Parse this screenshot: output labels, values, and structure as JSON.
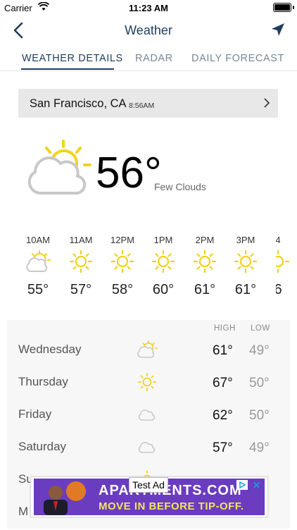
{
  "status_bar": {
    "carrier": "Carrier",
    "time": "11:23 AM"
  },
  "nav": {
    "title": "Weather"
  },
  "tabs": [
    {
      "label": "WEATHER DETAILS",
      "active": true
    },
    {
      "label": "RADAR",
      "active": false
    },
    {
      "label": "DAILY FORECAST",
      "active": false
    }
  ],
  "location": {
    "city": "San Francisco, CA",
    "time": "8:56AM"
  },
  "current": {
    "temp": "56°",
    "condition": "Few Clouds",
    "icon": "partly-sunny-icon"
  },
  "hourly": [
    {
      "time": "10AM",
      "temp": "55°",
      "icon": "partly-sunny-icon"
    },
    {
      "time": "11AM",
      "temp": "57°",
      "icon": "sun-icon"
    },
    {
      "time": "12PM",
      "temp": "58°",
      "icon": "sun-icon"
    },
    {
      "time": "1PM",
      "temp": "60°",
      "icon": "sun-icon"
    },
    {
      "time": "2PM",
      "temp": "61°",
      "icon": "sun-icon"
    },
    {
      "time": "3PM",
      "temp": "61°",
      "icon": "sun-icon"
    },
    {
      "time": "4",
      "temp": "6",
      "icon": "sun-icon"
    }
  ],
  "daily": {
    "high_label": "HIGH",
    "low_label": "LOW",
    "days": [
      {
        "day": "Wednesday",
        "high": "61°",
        "low": "49°",
        "icon": "partly-sunny-icon"
      },
      {
        "day": "Thursday",
        "high": "67°",
        "low": "50°",
        "icon": "sun-icon"
      },
      {
        "day": "Friday",
        "high": "62°",
        "low": "50°",
        "icon": "cloud-icon"
      },
      {
        "day": "Saturday",
        "high": "57°",
        "low": "49°",
        "icon": "cloud-icon"
      },
      {
        "day": "Su",
        "high": "",
        "low": "",
        "icon": "sun-icon"
      },
      {
        "day": "M",
        "high": "",
        "low": "",
        "icon": "sun-icon"
      }
    ]
  },
  "ad": {
    "label": "Test Ad",
    "line1": "APARTMENTS.COM",
    "line2": "MOVE IN BEFORE TIP-OFF."
  },
  "colors": {
    "accent": "#1f3d5c",
    "sun": "#f2d21b",
    "cloud": "#c8c8c8"
  }
}
